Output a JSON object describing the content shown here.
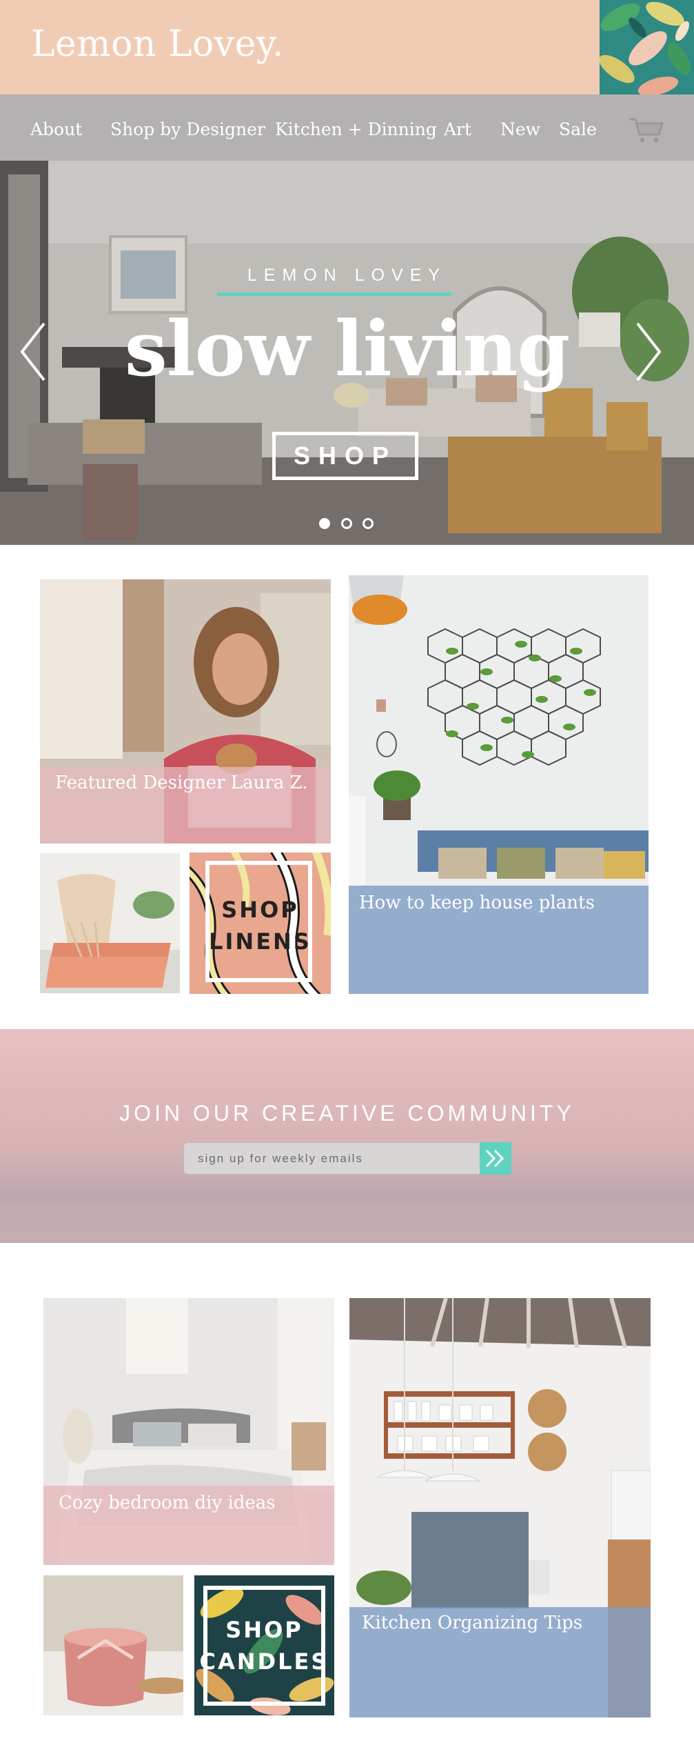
{
  "header": {
    "brand": "Lemon Lovey."
  },
  "nav": {
    "items": [
      {
        "label": "About"
      },
      {
        "label": "Shop by Designer"
      },
      {
        "label": "Kitchen + Dinning"
      },
      {
        "label": "Art"
      },
      {
        "label": "New"
      },
      {
        "label": "Sale"
      }
    ],
    "cart_icon": "shopping-cart-icon"
  },
  "hero": {
    "kicker": "LEMON LOVEY",
    "title": "slow living",
    "button": "SHOP",
    "slides_total": 3,
    "active_slide": 1
  },
  "tiles_top": {
    "featured_designer": "Featured Designer Laura Z.",
    "house_plants": "How to keep house plants",
    "shop_linens_line1": "SHOP",
    "shop_linens_line2": "LINENS"
  },
  "community": {
    "title": "JOIN OUR CREATIVE COMMUNITY",
    "placeholder": "sign up for weekly emails",
    "submit_icon": "double-chevron-right-icon"
  },
  "tiles_bottom": {
    "bedroom": "Cozy bedroom diy ideas",
    "kitchen": "Kitchen Organizing Tips",
    "shop_candles_line1": "SHOP",
    "shop_candles_line2": "CANDLES"
  },
  "colors": {
    "header_bg": "#f1ccb5",
    "nav_bg": "#b4b1b2",
    "accent_mint": "#5fd3bf",
    "pink_band": "#e6b9bd",
    "blue_band": "#7e9cc4"
  }
}
